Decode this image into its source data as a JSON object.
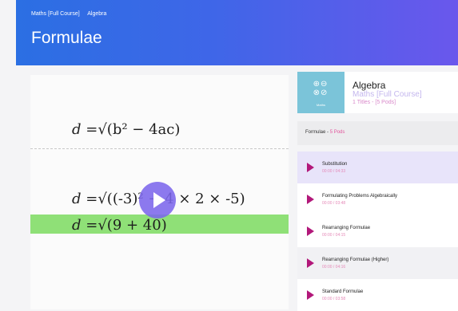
{
  "header": {
    "breadcrumbs": [
      "Maths [Full Course]",
      "Algebra"
    ],
    "title": "Formulae"
  },
  "video": {
    "formula_1": {
      "var": "d",
      "rest": " =√(b² − 4ac)"
    },
    "formula_2": {
      "var": "d",
      "rest": " =√((-3)² − 4 × 2 × -5)"
    },
    "formula_3": {
      "var": "d",
      "rest": " =√(9 + 40)"
    },
    "play_icon": "play-icon",
    "highlight_color": "#8fe077"
  },
  "course": {
    "thumb_label": "Maths",
    "title": "Algebra",
    "subtitle": "Maths [Full Course]",
    "meta": "1 Titles - [5 Pods]"
  },
  "section": {
    "name": "Formulae",
    "separator": " - ",
    "count": "5 Pods"
  },
  "lessons": [
    {
      "title": "Substitution",
      "time": "00:00 / 04:33"
    },
    {
      "title": "Formulating Problems Algebraically",
      "time": "00:00 / 03:48"
    },
    {
      "title": "Rearranging Formulae",
      "time": "00:00 / 04:15"
    },
    {
      "title": "Rearranging Formulae (Higher)",
      "time": "00:00 / 04:16"
    },
    {
      "title": "Standard Formulae",
      "time": "00:00 / 03:58"
    }
  ],
  "colors": {
    "accent": "#6a57ec",
    "lesson_icon": "#b2187a",
    "pink_text": "#e2559c"
  }
}
